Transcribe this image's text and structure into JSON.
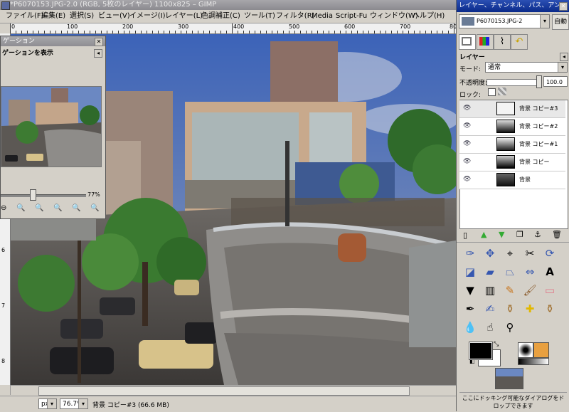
{
  "window": {
    "title": "*P6070153.JPG-2.0 (RGB, 5枚のレイヤー) 1100x825 – GIMP"
  },
  "menubar": {
    "items": [
      "ファイル(F)",
      "編集(E)",
      "選択(S)",
      "ビュー(V)",
      "イメージ(I)",
      "レイヤー(L)",
      "色調補正(C)",
      "ツール(T)",
      "フィルタ(R)",
      "Media",
      "Script-Fu",
      "ウィンドウ(W)",
      "ヘルプ(H)"
    ]
  },
  "hruler": {
    "ticks": [
      "0",
      "100",
      "200",
      "300",
      "400",
      "500",
      "600",
      "700",
      "800"
    ]
  },
  "vruler": {
    "ticks": [
      "6",
      "7",
      "8"
    ]
  },
  "navigation": {
    "title": "ゲーション",
    "subtitle": "ゲーションを表示",
    "zoom_text": "77%",
    "zoom_level_fraction": 0.34
  },
  "statusbar": {
    "unit": "px",
    "zoom": "76.7%",
    "message": "背景 コピー#3 (66.6 MB)"
  },
  "dock": {
    "title": "レイヤー、チャンネル、パス、アンドゥ",
    "image_select": "P6070153.JPG-2",
    "auto_button": "自動",
    "panel_title": "レイヤー",
    "mode_label": "モード:",
    "mode_value": "通常",
    "opacity_label": "不透明度:",
    "opacity_value": "100.0",
    "lock_label": "ロック:",
    "layers": [
      {
        "name": "背景 コピー#3",
        "active": true
      },
      {
        "name": "背景 コピー#2",
        "active": false
      },
      {
        "name": "背景 コピー#1",
        "active": false
      },
      {
        "name": "背景 コピー",
        "active": false
      },
      {
        "name": "背景",
        "active": false
      }
    ],
    "dock_hint": "ここにドッキング可能なダイアログをドロップできます"
  },
  "toolbox": {
    "tools": [
      "bezier-path-icon",
      "move-icon",
      "align-icon",
      "crop-icon",
      "rotate-icon",
      "scale-icon",
      "shear-icon",
      "perspective-icon",
      "flip-icon",
      "text-icon",
      "bucket-fill-icon",
      "blend-icon",
      "pencil-icon",
      "paintbrush-icon",
      "eraser-icon",
      "airbrush-icon",
      "ink-icon",
      "clone-icon",
      "heal-icon",
      "perspective-clone-icon",
      "blur-icon",
      "smudge-icon",
      "dodge-burn-icon"
    ],
    "fg_color": "#000000",
    "bg_color": "#ffffff"
  },
  "colors": {
    "dock_title": "#0a2a8a",
    "window_title": "#8b8a8f"
  }
}
